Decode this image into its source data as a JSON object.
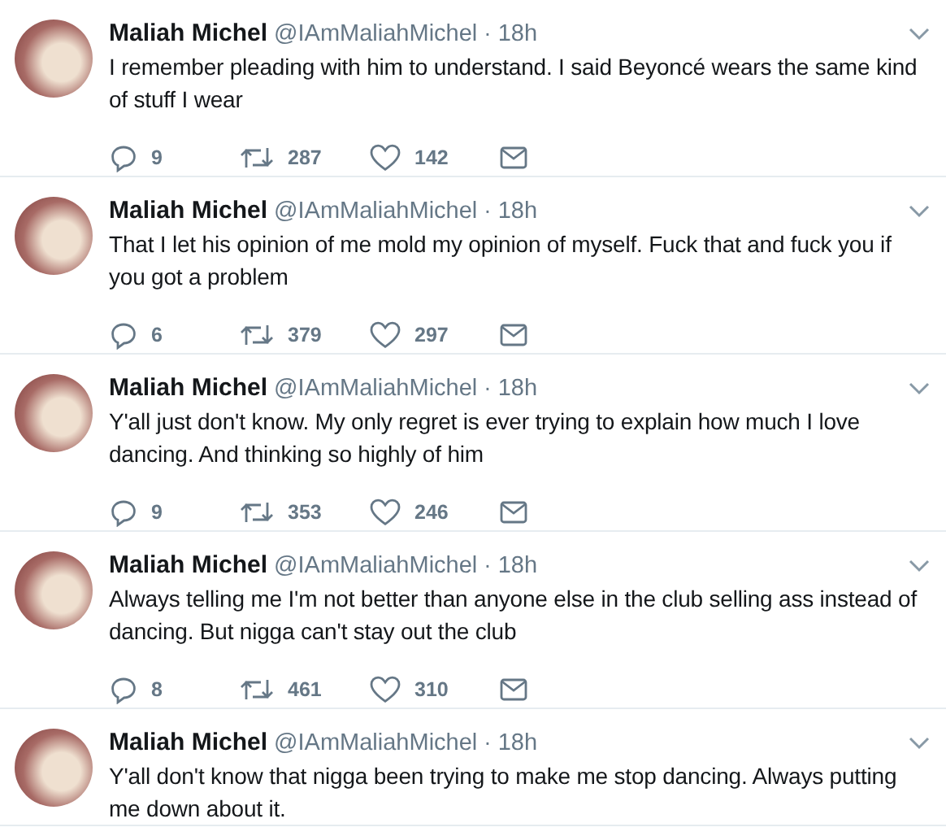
{
  "tweets": [
    {
      "name": "Maliah Michel",
      "handle": "@IAmMaliahMichel",
      "separator": "·",
      "time": "18h",
      "text": "I remember pleading with him to understand. I said Beyoncé wears the same kind of stuff I wear",
      "replies": "9",
      "retweets": "287",
      "likes": "142"
    },
    {
      "name": "Maliah Michel",
      "handle": "@IAmMaliahMichel",
      "separator": "·",
      "time": "18h",
      "text": "That I let his opinion of me mold my opinion of myself. Fuck that and fuck you if you got a problem",
      "replies": "6",
      "retweets": "379",
      "likes": "297"
    },
    {
      "name": "Maliah Michel",
      "handle": "@IAmMaliahMichel",
      "separator": "·",
      "time": "18h",
      "text": "Y'all just don't know. My only regret is ever trying to explain how much I love dancing. And thinking so highly of him",
      "replies": "9",
      "retweets": "353",
      "likes": "246"
    },
    {
      "name": "Maliah Michel",
      "handle": "@IAmMaliahMichel",
      "separator": "·",
      "time": "18h",
      "text": "Always telling me I'm not better than anyone else in the club selling ass instead of dancing. But nigga can't stay out the club",
      "replies": "8",
      "retweets": "461",
      "likes": "310"
    },
    {
      "name": "Maliah Michel",
      "handle": "@IAmMaliahMichel",
      "separator": "·",
      "time": "18h",
      "text": "Y'all don't know that nigga been trying to make me stop dancing. Always putting me down about it."
    }
  ]
}
